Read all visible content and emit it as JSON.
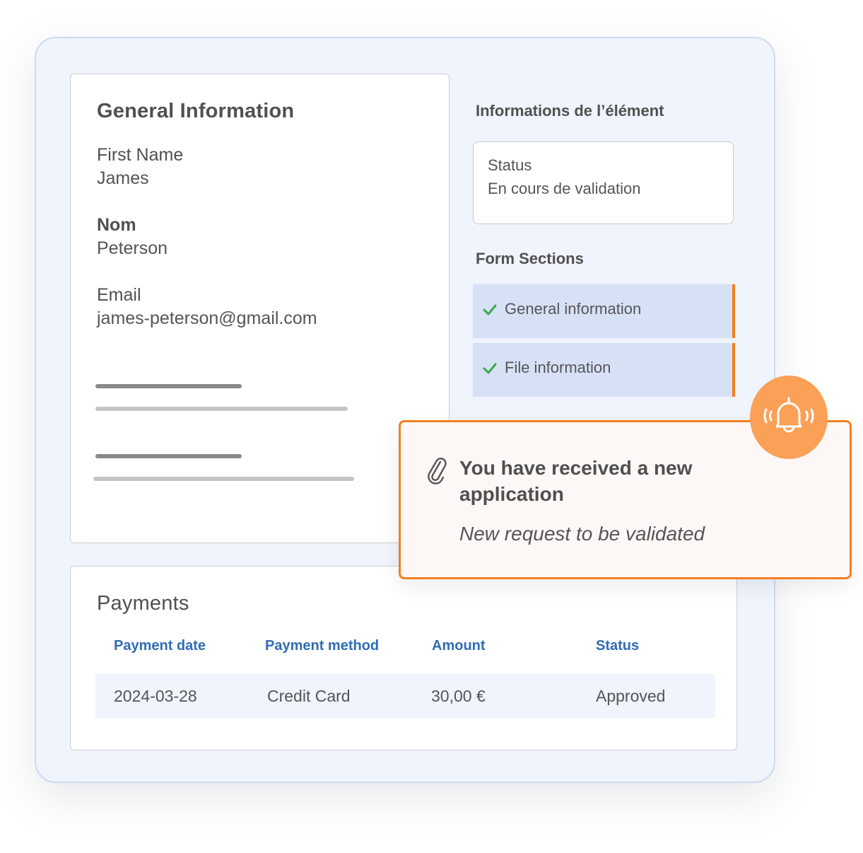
{
  "general": {
    "title": "General Information",
    "fields": [
      {
        "label": "First Name",
        "value": "James"
      },
      {
        "label": "Nom",
        "value": "Peterson"
      },
      {
        "label": "Email",
        "value": "james-peterson@gmail.com"
      }
    ]
  },
  "element_info": {
    "heading": "Informations de l’élément",
    "status_label": "Status",
    "status_value": "En cours de validation"
  },
  "form_sections": {
    "heading": "Form Sections",
    "items": [
      {
        "label": "General information",
        "icon": "check-icon",
        "completed": true
      },
      {
        "label": "File information",
        "icon": "check-icon",
        "completed": true
      }
    ]
  },
  "notification": {
    "icon": "paperclip-icon",
    "badge_icon": "bell-ringing-icon",
    "title": "You have received a new application",
    "subtitle": "New request to be validated"
  },
  "payments": {
    "title": "Payments",
    "columns": [
      "Payment date",
      "Payment method",
      "Amount",
      "Status"
    ],
    "rows": [
      [
        "2024-03-28",
        "Credit Card",
        "30,00 €",
        "Approved"
      ]
    ]
  },
  "colors": {
    "accent_orange": "#f47f1f",
    "bell_orange": "#fba057",
    "link_blue": "#2f6db5",
    "check_green": "#3aa84a",
    "section_bg": "#d6e1f6",
    "frame_bg": "#eff4fd"
  }
}
